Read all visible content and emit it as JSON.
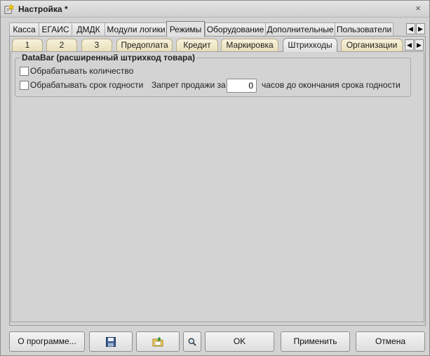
{
  "window": {
    "title": "Настройка *",
    "close_glyph": "×"
  },
  "top_tabs": {
    "items": [
      "Касса",
      "ЕГАИС",
      "ДМДК",
      "Модули логики",
      "Режимы",
      "Оборудование",
      "Дополнительные",
      "Пользователи"
    ],
    "active": "Режимы",
    "scroll_left": "◀",
    "scroll_right": "▶"
  },
  "inner_tabs": {
    "items": [
      "1",
      "2",
      "3",
      "Предоплата",
      "Кредит",
      "Маркировка",
      "Штрихкоды",
      "Организации"
    ],
    "active": "Штрихкоды",
    "scroll_left": "◀",
    "scroll_right": "▶"
  },
  "databar_group": {
    "title": "DataBar (расширенный штрихкод товара)",
    "process_quantity_label": "Обрабатывать количество",
    "process_quantity_checked": false,
    "process_expiry_label": "Обрабатывать срок годности",
    "process_expiry_checked": false,
    "sale_ban_label": "Запрет продажи за",
    "sale_ban_hours_value": "0",
    "sale_ban_suffix": "часов до окончания срока годности"
  },
  "footer": {
    "about_label": "О программе...",
    "save_icon": "floppy-disk-icon",
    "folder_icon": "folder-icon",
    "search_icon": "magnifier-icon",
    "ok_label": "OK",
    "apply_label": "Применить",
    "cancel_label": "Отмена"
  }
}
